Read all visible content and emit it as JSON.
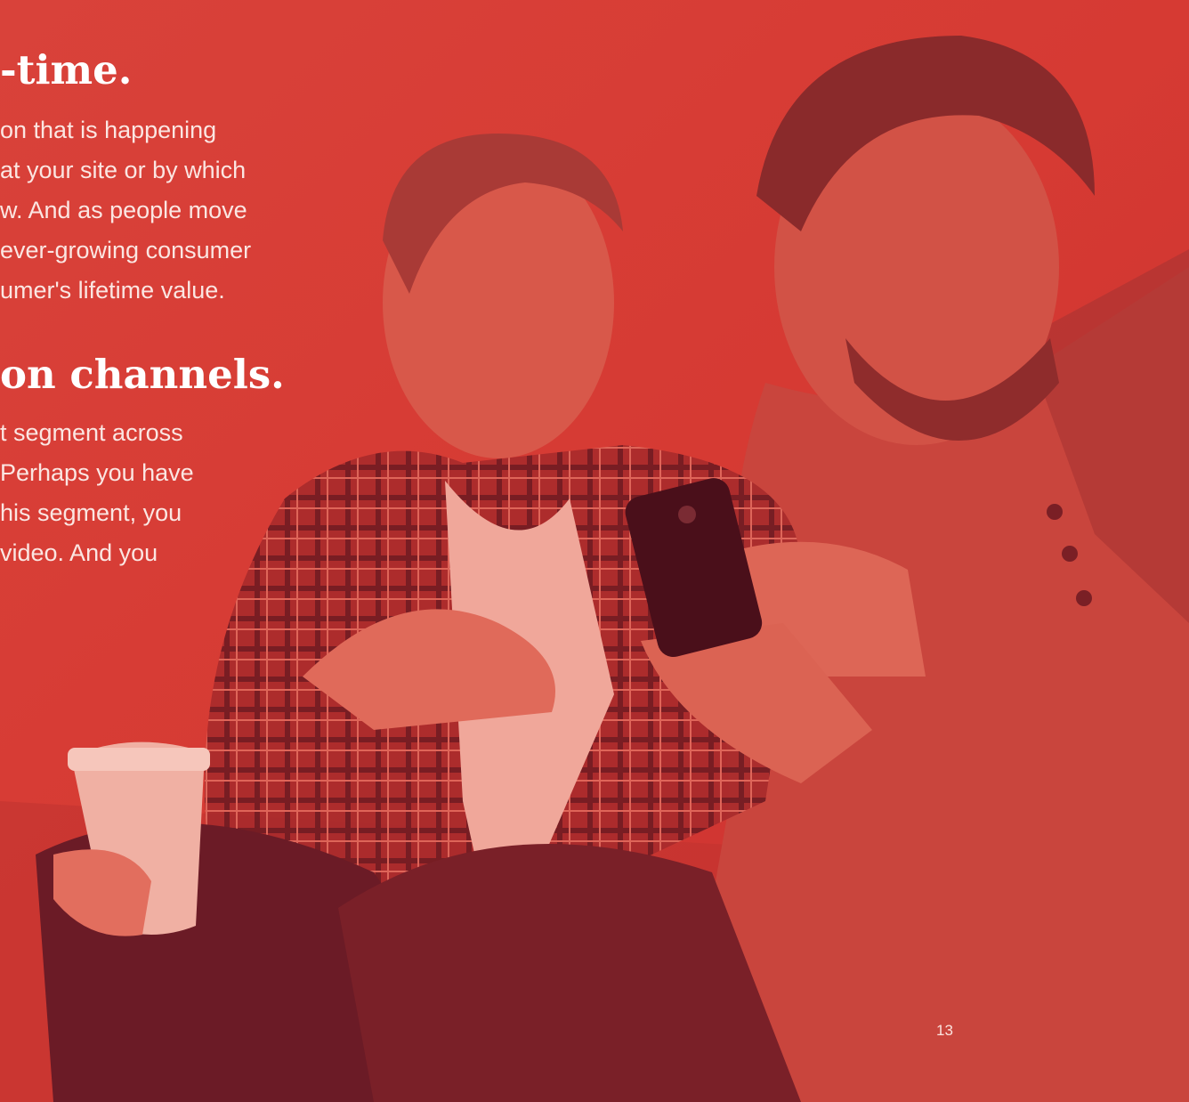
{
  "page": {
    "heading_1": "-time.",
    "para_1": [
      "on that is happening",
      "at your site or by which",
      "w. And as people move",
      "ever-growing consumer",
      "umer's lifetime value."
    ],
    "heading_2": "on channels.",
    "para_2": [
      "t segment across",
      "Perhaps you have",
      "his segment, you",
      "video. And you"
    ],
    "page_number": "13"
  },
  "colors": {
    "overlay": "#d63a33",
    "text": "#ffffff"
  }
}
